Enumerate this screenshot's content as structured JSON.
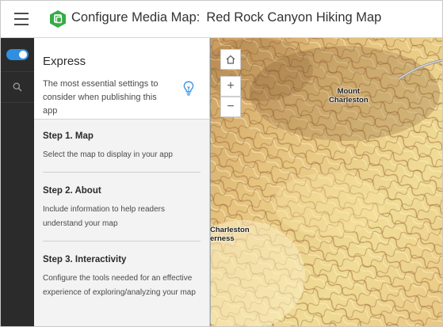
{
  "header": {
    "title_prefix": "Configure Media Map:",
    "title_map": "Red Rock Canyon Hiking Map"
  },
  "colors": {
    "accent": "#2f8fe0",
    "logo": "#35ac46",
    "rail": "#2b2b2b",
    "panel_bg": "#f3f3f3"
  },
  "rail": {
    "toggle_on": true,
    "toggle_icon": "toggle-icon",
    "search_icon": "search-icon"
  },
  "panel": {
    "title": "Express",
    "description": "The most essential settings to consider when publishing this app",
    "tip_icon": "lightbulb-icon",
    "steps": [
      {
        "title": "Step 1. Map",
        "description": "Select the map to display in your app"
      },
      {
        "title": "Step 2. About",
        "description": "Include information to help readers understand your map"
      },
      {
        "title": "Step 3. Interactivity",
        "description": "Configure the tools needed for an effective experience of exploring/analyzing your map"
      }
    ]
  },
  "map": {
    "controls": {
      "home_icon": "home-icon",
      "zoom_in": "+",
      "zoom_out": "−"
    },
    "labels": {
      "mount_charleston_line1": "Mount",
      "mount_charleston_line2": "Charleston",
      "wilderness_line1": "Charleston",
      "wilderness_line2": "erness"
    }
  }
}
